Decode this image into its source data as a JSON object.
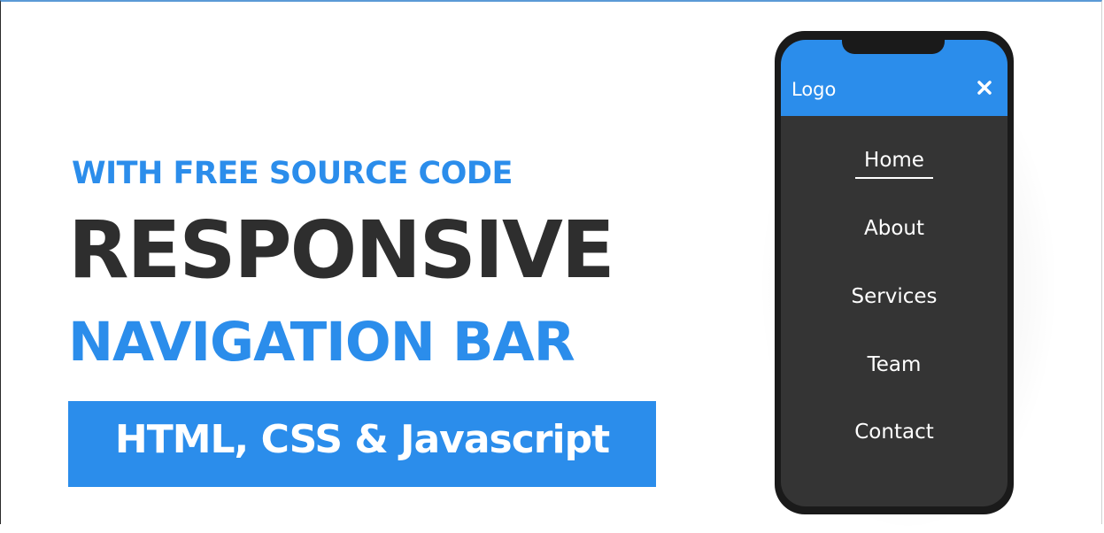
{
  "banner": {
    "subtitle": "WITH FREE SOURCE CODE",
    "title_line1": "RESPONSIVE",
    "title_line2": "NAVIGATION BAR",
    "tech": "HTML, CSS & Javascript"
  },
  "phone": {
    "logo": "Logo",
    "close_icon": "close-icon",
    "menu": {
      "items": [
        {
          "label": "Home",
          "active": true
        },
        {
          "label": "About",
          "active": false
        },
        {
          "label": "Services",
          "active": false
        },
        {
          "label": "Team",
          "active": false
        },
        {
          "label": "Contact",
          "active": false
        }
      ]
    }
  },
  "colors": {
    "accent": "#2b8deb",
    "dark_text": "#2e2e2e",
    "phone_body": "#1a1a1a",
    "phone_screen": "#343434"
  }
}
